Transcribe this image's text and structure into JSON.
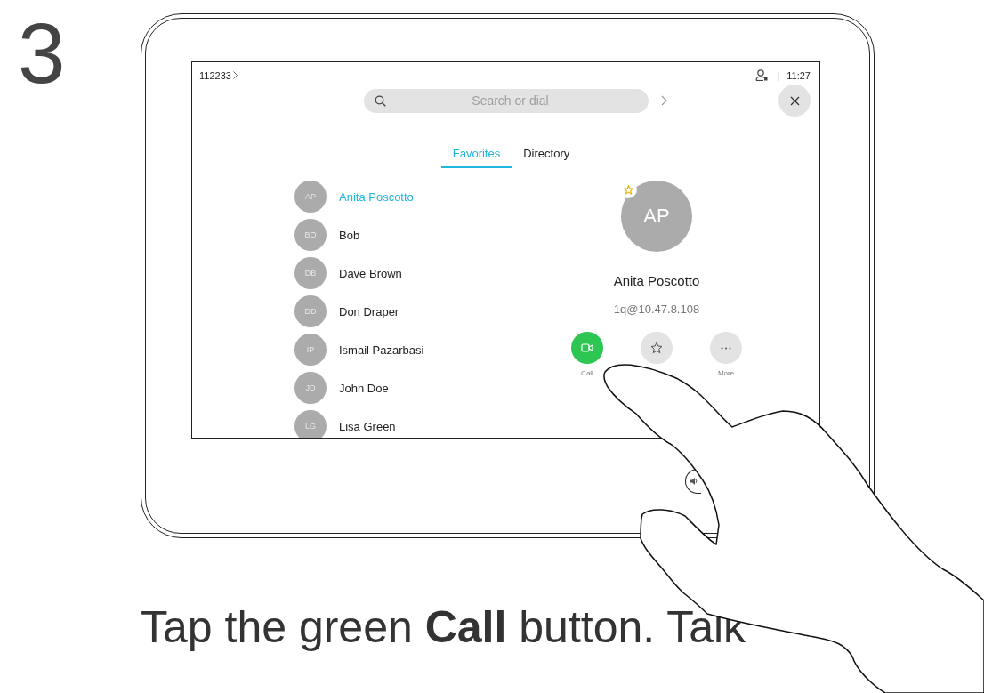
{
  "step": "3",
  "device": {
    "status_bar": {
      "number": "112233",
      "separator": "|",
      "time": "11:27"
    },
    "search": {
      "placeholder": "Search or dial"
    },
    "tabs": [
      {
        "label": "Favorites",
        "selected": true
      },
      {
        "label": "Directory",
        "selected": false
      }
    ],
    "contacts": [
      {
        "initials": "AP",
        "name": "Anita Poscotto",
        "selected": true
      },
      {
        "initials": "BO",
        "name": "Bob",
        "selected": false
      },
      {
        "initials": "DB",
        "name": "Dave Brown",
        "selected": false
      },
      {
        "initials": "DD",
        "name": "Don Draper",
        "selected": false
      },
      {
        "initials": "IP",
        "name": "Ismail Pazarbasi",
        "selected": false
      },
      {
        "initials": "JD",
        "name": "John Doe",
        "selected": false
      },
      {
        "initials": "LG",
        "name": "Lisa Green",
        "selected": false
      }
    ],
    "detail": {
      "initials": "AP",
      "favorite": true,
      "name": "Anita Poscotto",
      "address": "1q@10.47.8.108",
      "actions": [
        {
          "kind": "call",
          "label": "Call"
        },
        {
          "kind": "favorite"
        },
        {
          "kind": "more",
          "label": "More"
        }
      ]
    }
  },
  "caption": "Tap the green **Call** button. Talk"
}
